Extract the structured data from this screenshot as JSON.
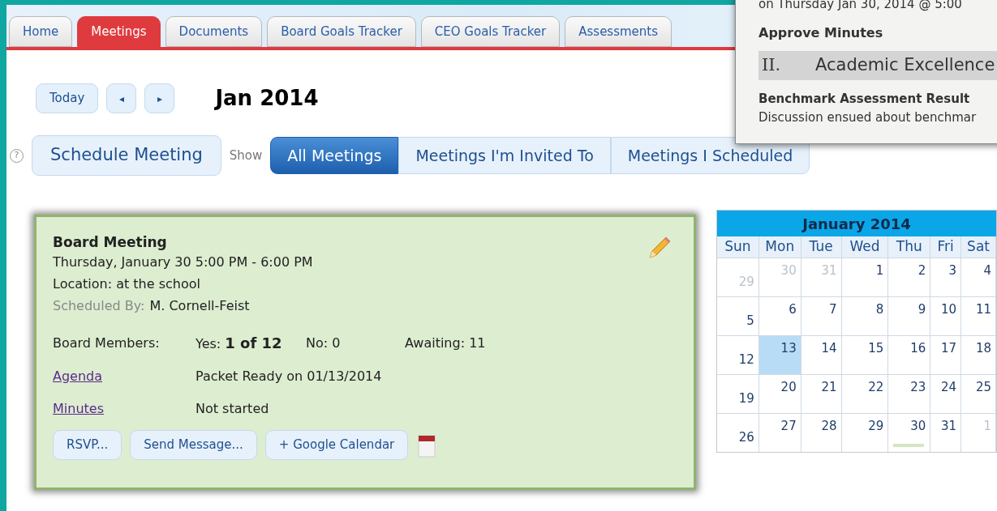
{
  "tabs": [
    {
      "label": "Home",
      "selected": false
    },
    {
      "label": "Meetings",
      "selected": true
    },
    {
      "label": "Documents",
      "selected": false
    },
    {
      "label": "Board Goals Tracker",
      "selected": false
    },
    {
      "label": "CEO Goals Tracker",
      "selected": false
    },
    {
      "label": "Assessments",
      "selected": false
    }
  ],
  "popup": {
    "date_line": "on Thursday Jan 30, 2014 @ 5:00",
    "item_title": "Approve Minutes",
    "section_number": "II.",
    "section_title": "Academic Excellence",
    "sub_title": "Benchmark Assessment Result",
    "sub_text": "Discussion ensued about benchmar"
  },
  "toolbar": {
    "today": "Today",
    "prev": "◂",
    "next": "▸",
    "period": "Jan 2014"
  },
  "help_icon": "?",
  "schedule_button": "Schedule Meeting",
  "show_label": "Show",
  "filters": [
    {
      "label": "All Meetings",
      "selected": true
    },
    {
      "label": "Meetings I'm Invited To",
      "selected": false
    },
    {
      "label": "Meetings I Scheduled",
      "selected": false
    }
  ],
  "meeting": {
    "title": "Board Meeting",
    "when": "Thursday, January 30 5:00 PM - 6:00 PM",
    "location": "Location: at the school",
    "scheduled_by_label": "Scheduled By:",
    "scheduled_by": "M. Cornell-Feist",
    "members_label": "Board Members:",
    "yes_label": "Yes:",
    "yes_value": "1 of 12",
    "no": "No: 0",
    "awaiting": "Awaiting: 11",
    "links": [
      {
        "label": "Agenda",
        "status": "Packet Ready on 01/13/2014"
      },
      {
        "label": "Minutes",
        "status": "Not started"
      }
    ],
    "buttons": [
      "RSVP...",
      "Send Message...",
      "+ Google Calendar"
    ]
  },
  "calendar": {
    "title": "January 2014",
    "weekdays": [
      "Sun",
      "Mon",
      "Tue",
      "Wed",
      "Thu",
      "Fri",
      "Sat"
    ],
    "weeks": [
      [
        {
          "day": "29",
          "muted": true,
          "selected": false,
          "event": false
        },
        {
          "day": "30",
          "muted": true,
          "selected": false,
          "event": false
        },
        {
          "day": "31",
          "muted": true,
          "selected": false,
          "event": false
        },
        {
          "day": "1",
          "muted": false,
          "selected": false,
          "event": false
        },
        {
          "day": "2",
          "muted": false,
          "selected": false,
          "event": false
        },
        {
          "day": "3",
          "muted": false,
          "selected": false,
          "event": false
        },
        {
          "day": "4",
          "muted": false,
          "selected": false,
          "event": false
        }
      ],
      [
        {
          "day": "5",
          "muted": false,
          "selected": false,
          "event": false
        },
        {
          "day": "6",
          "muted": false,
          "selected": false,
          "event": false
        },
        {
          "day": "7",
          "muted": false,
          "selected": false,
          "event": false
        },
        {
          "day": "8",
          "muted": false,
          "selected": false,
          "event": false
        },
        {
          "day": "9",
          "muted": false,
          "selected": false,
          "event": false
        },
        {
          "day": "10",
          "muted": false,
          "selected": false,
          "event": false
        },
        {
          "day": "11",
          "muted": false,
          "selected": false,
          "event": false
        }
      ],
      [
        {
          "day": "12",
          "muted": false,
          "selected": false,
          "event": false
        },
        {
          "day": "13",
          "muted": false,
          "selected": true,
          "event": false
        },
        {
          "day": "14",
          "muted": false,
          "selected": false,
          "event": false
        },
        {
          "day": "15",
          "muted": false,
          "selected": false,
          "event": false
        },
        {
          "day": "16",
          "muted": false,
          "selected": false,
          "event": false
        },
        {
          "day": "17",
          "muted": false,
          "selected": false,
          "event": false
        },
        {
          "day": "18",
          "muted": false,
          "selected": false,
          "event": false
        }
      ],
      [
        {
          "day": "19",
          "muted": false,
          "selected": false,
          "event": false
        },
        {
          "day": "20",
          "muted": false,
          "selected": false,
          "event": false
        },
        {
          "day": "21",
          "muted": false,
          "selected": false,
          "event": false
        },
        {
          "day": "22",
          "muted": false,
          "selected": false,
          "event": false
        },
        {
          "day": "23",
          "muted": false,
          "selected": false,
          "event": false
        },
        {
          "day": "24",
          "muted": false,
          "selected": false,
          "event": false
        },
        {
          "day": "25",
          "muted": false,
          "selected": false,
          "event": false
        }
      ],
      [
        {
          "day": "26",
          "muted": false,
          "selected": false,
          "event": false
        },
        {
          "day": "27",
          "muted": false,
          "selected": false,
          "event": false
        },
        {
          "day": "28",
          "muted": false,
          "selected": false,
          "event": false
        },
        {
          "day": "29",
          "muted": false,
          "selected": false,
          "event": false
        },
        {
          "day": "30",
          "muted": false,
          "selected": false,
          "event": true
        },
        {
          "day": "31",
          "muted": false,
          "selected": false,
          "event": false
        },
        {
          "day": "1",
          "muted": true,
          "selected": false,
          "event": false
        }
      ]
    ]
  }
}
